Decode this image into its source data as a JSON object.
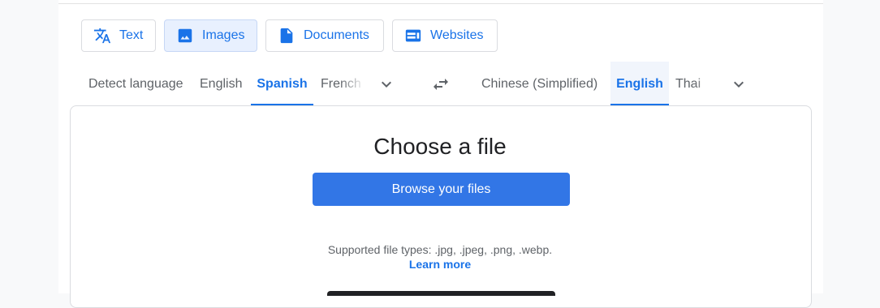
{
  "modes": [
    {
      "label": "Text",
      "icon": "translate-icon",
      "active": false
    },
    {
      "label": "Images",
      "icon": "image-icon",
      "active": true
    },
    {
      "label": "Documents",
      "icon": "document-icon",
      "active": false
    },
    {
      "label": "Websites",
      "icon": "website-icon",
      "active": false
    }
  ],
  "source_languages": [
    {
      "label": "Detect language",
      "selected": false
    },
    {
      "label": "English",
      "selected": false
    },
    {
      "label": "Spanish",
      "selected": true
    },
    {
      "label": "French",
      "selected": false
    }
  ],
  "target_languages": [
    {
      "label": "Chinese (Simplified)",
      "selected": false
    },
    {
      "label": "English",
      "selected": true
    },
    {
      "label": "Thai",
      "selected": false
    }
  ],
  "upload": {
    "title": "Choose a file",
    "browse_label": "Browse your files",
    "supported_text": "Supported file types: .jpg, .jpeg, .png, .webp.",
    "learn_more": "Learn more"
  },
  "colors": {
    "accent": "#1a73e8",
    "button": "#3276e6",
    "text_secondary": "#5f6368"
  }
}
